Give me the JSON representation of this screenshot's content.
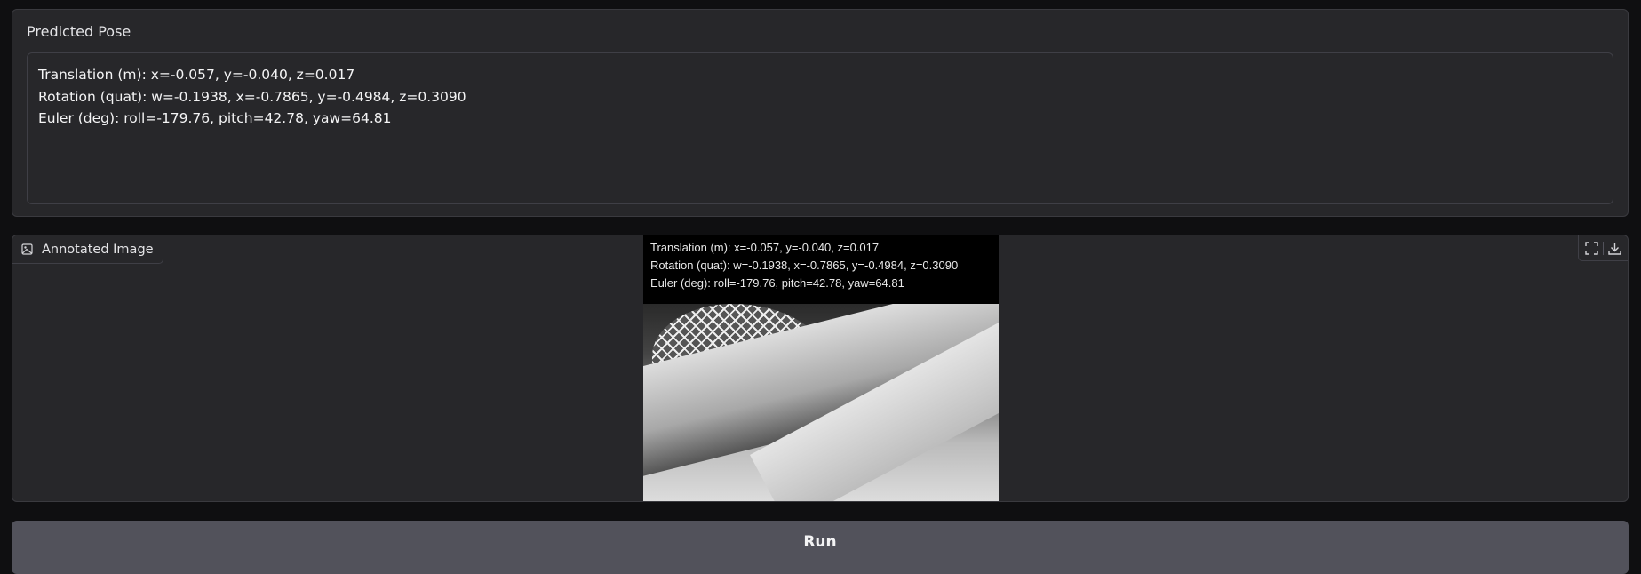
{
  "pose_panel": {
    "title": "Predicted Pose",
    "lines": [
      "Translation (m): x=-0.057, y=-0.040, z=0.017",
      "Rotation (quat): w=-0.1938, x=-0.7865, y=-0.4984, z=0.3090",
      "Euler (deg): roll=-179.76, pitch=42.78, yaw=64.81"
    ]
  },
  "image_panel": {
    "label": "Annotated Image",
    "label_icon": "image-icon",
    "overlay_lines": [
      "Translation (m): x=-0.057, y=-0.040, z=0.017",
      "Rotation (quat): w=-0.1938, x=-0.7865, y=-0.4984, z=0.3090",
      "Euler (deg): roll=-179.76, pitch=42.78, yaw=64.81"
    ],
    "actions": [
      "fullscreen-icon",
      "download-icon"
    ]
  },
  "run_button": {
    "label": "Run"
  }
}
